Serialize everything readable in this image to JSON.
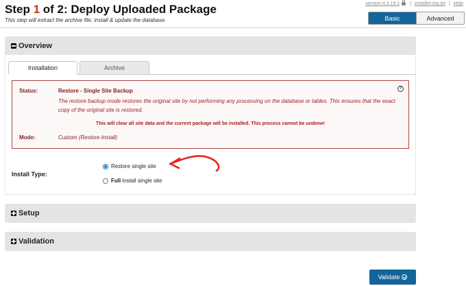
{
  "header": {
    "title_prefix": "Step ",
    "step_current": "1",
    "title_suffix": " of 2: Deploy Uploaded Package",
    "subtitle": "This step will extract the archive file, install & update the database."
  },
  "meta": {
    "version": "version:4.5.19.1",
    "log_link": "installer-log.txt",
    "help_link": "Help",
    "separator": "|"
  },
  "mode_toggle": {
    "basic_label": "Basic",
    "advanced_label": "Advanced",
    "selected": "Basic"
  },
  "overview": {
    "title": "Overview",
    "tabs": [
      {
        "label": "Installation",
        "active": true
      },
      {
        "label": "Archive",
        "active": false
      }
    ],
    "status": {
      "status_label": "Status:",
      "status_title": "Restore - Single Site Backup",
      "description": "The restore backup mode restores the original site by not performing any processing on the database or tables. This ensures that the exact copy of the original site is restored.",
      "warning": "This will clear all site data and the current package will be installed. This process cannot be undone!",
      "mode_label": "Mode:",
      "mode_value": "Custom",
      "mode_note": "(Restore Install)",
      "help_glyph": "?"
    },
    "install_type": {
      "label": "Install Type:",
      "options": [
        {
          "bold": "",
          "text": "Restore single site",
          "checked": true
        },
        {
          "bold": "Full",
          "text": "install single site",
          "checked": false
        }
      ]
    }
  },
  "sections": {
    "setup_title": "Setup",
    "validation_title": "Validation"
  },
  "validate_button": {
    "label": "Validate"
  },
  "colors": {
    "accent": "#13659c",
    "step_number": "#c8311d",
    "status_text": "#7d1d1d",
    "warning_text": "#a01e1e",
    "annotation_arrow": "#e8221e",
    "panel_header": "#e4e4e4"
  }
}
